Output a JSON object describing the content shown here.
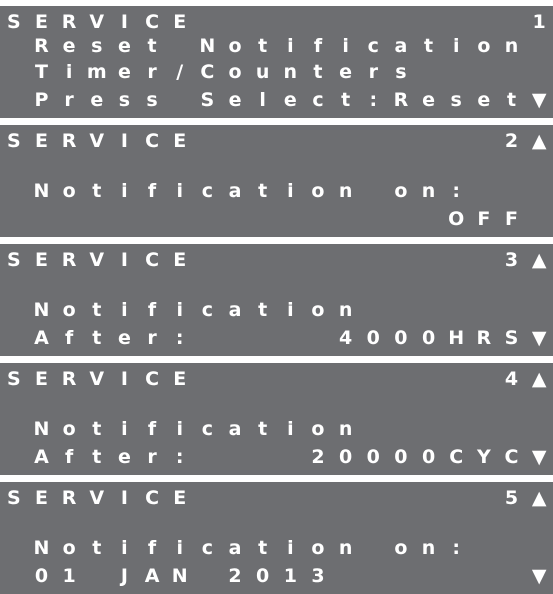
{
  "screens": [
    {
      "lines": [
        "SERVICE            1",
        " Reset Notification ",
        " Timer/Counters     ",
        " Press Select:Reset▼"
      ]
    },
    {
      "lines": [
        "SERVICE           2▲",
        "                    ",
        " Notification on:   ",
        "                OFF ▼"
      ]
    },
    {
      "lines": [
        "SERVICE           3▲",
        "                    ",
        " Notification       ",
        " After:     4000HRS▼"
      ]
    },
    {
      "lines": [
        "SERVICE           4▲",
        "                    ",
        " Notification       ",
        " After:    20000CYC▼"
      ]
    },
    {
      "lines": [
        "SERVICE           5▲",
        "                    ",
        " Notification on:   ",
        " 01 JAN 2013       ▼"
      ]
    }
  ]
}
